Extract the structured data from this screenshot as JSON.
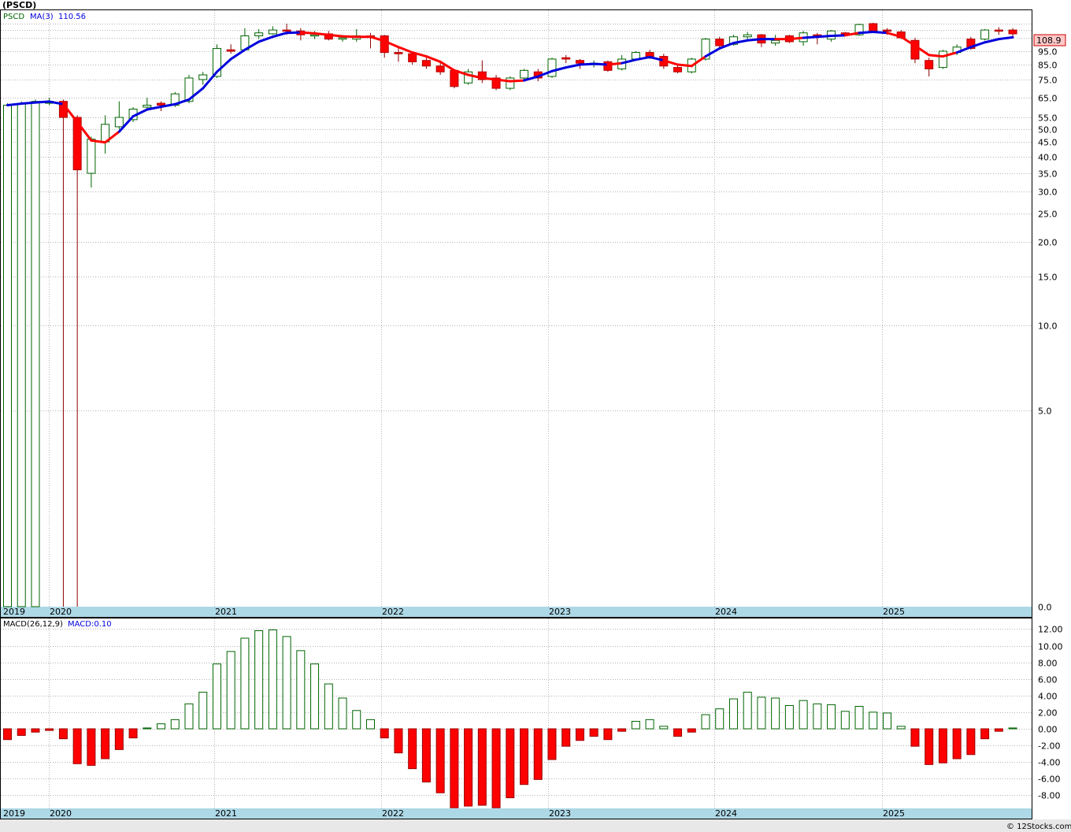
{
  "title": "(PSCD)",
  "footer": "© 12Stocks.com",
  "colors": {
    "up_candle": "#006400",
    "down_candle": "#ff0000",
    "ma_up": "#0000dd",
    "ma_down": "#ff0000",
    "axis_band": "#add8e6",
    "grid": "#b4b4b4",
    "price_badge": "#ffc8c8"
  },
  "chart_data": [
    {
      "type": "candlestick",
      "name": "price",
      "yscale": "log",
      "legend": {
        "symbol": "PSCD",
        "ma_label": "MA(3)",
        "ma_value": "110.56"
      },
      "last_price_label": "108.9",
      "y_ticks": [
        "0.0",
        "5.0",
        "10.0",
        "15.0",
        "20.0",
        "25.0",
        "30.0",
        "35.0",
        "40.0",
        "45.0",
        "50.0",
        "55.0",
        "65.0",
        "75.0",
        "85.0",
        "95.0",
        "105.0"
      ],
      "x_labels": [
        "2019",
        "2020",
        "2021",
        "2022",
        "2023",
        "2024",
        "2025"
      ],
      "grid": true,
      "candles": [
        {
          "o": 0.1,
          "h": 62,
          "l": 0.1,
          "c": 61,
          "dir": "up"
        },
        {
          "o": 0.1,
          "h": 63,
          "l": 0.1,
          "c": 62,
          "dir": "up"
        },
        {
          "o": 0.1,
          "h": 64,
          "l": 0.1,
          "c": 63,
          "dir": "up"
        },
        {
          "o": 62,
          "h": 65,
          "l": 61,
          "c": 63,
          "dir": "up"
        },
        {
          "o": 63,
          "h": 64,
          "l": 0.1,
          "c": 55,
          "dir": "down"
        },
        {
          "o": 55,
          "h": 56,
          "l": 0.1,
          "c": 36,
          "dir": "down"
        },
        {
          "o": 35,
          "h": 47,
          "l": 31,
          "c": 46,
          "dir": "up"
        },
        {
          "o": 45,
          "h": 56,
          "l": 41,
          "c": 52,
          "dir": "up"
        },
        {
          "o": 51,
          "h": 63,
          "l": 50,
          "c": 55,
          "dir": "up"
        },
        {
          "o": 54,
          "h": 60,
          "l": 53,
          "c": 59,
          "dir": "up"
        },
        {
          "o": 60,
          "h": 65,
          "l": 59,
          "c": 61,
          "dir": "up"
        },
        {
          "o": 61,
          "h": 63,
          "l": 58,
          "c": 62,
          "dir": "down"
        },
        {
          "o": 61,
          "h": 68,
          "l": 60,
          "c": 67,
          "dir": "up"
        },
        {
          "o": 63,
          "h": 78,
          "l": 62,
          "c": 76,
          "dir": "up"
        },
        {
          "o": 75,
          "h": 80,
          "l": 72,
          "c": 78,
          "dir": "up"
        },
        {
          "o": 77,
          "h": 100,
          "l": 76,
          "c": 97,
          "dir": "up"
        },
        {
          "o": 95,
          "h": 100,
          "l": 93,
          "c": 96,
          "dir": "down"
        },
        {
          "o": 96,
          "h": 115,
          "l": 95,
          "c": 107,
          "dir": "up"
        },
        {
          "o": 107,
          "h": 114,
          "l": 104,
          "c": 110,
          "dir": "up"
        },
        {
          "o": 109,
          "h": 117,
          "l": 108,
          "c": 113,
          "dir": "up"
        },
        {
          "o": 113,
          "h": 120,
          "l": 108,
          "c": 112,
          "dir": "down"
        },
        {
          "o": 112,
          "h": 115,
          "l": 103,
          "c": 108,
          "dir": "down"
        },
        {
          "o": 108,
          "h": 112,
          "l": 104,
          "c": 108,
          "dir": "up"
        },
        {
          "o": 109,
          "h": 112,
          "l": 103,
          "c": 104,
          "dir": "down"
        },
        {
          "o": 104,
          "h": 107,
          "l": 102,
          "c": 105,
          "dir": "up"
        },
        {
          "o": 104,
          "h": 114,
          "l": 102,
          "c": 107,
          "dir": "up"
        },
        {
          "o": 107,
          "h": 110,
          "l": 97,
          "c": 106,
          "dir": "down"
        },
        {
          "o": 107,
          "h": 108,
          "l": 90,
          "c": 94,
          "dir": "down"
        },
        {
          "o": 94,
          "h": 97,
          "l": 87,
          "c": 93,
          "dir": "down"
        },
        {
          "o": 93,
          "h": 95,
          "l": 85,
          "c": 87,
          "dir": "down"
        },
        {
          "o": 88,
          "h": 90,
          "l": 82,
          "c": 84,
          "dir": "down"
        },
        {
          "o": 84,
          "h": 86,
          "l": 78,
          "c": 80,
          "dir": "down"
        },
        {
          "o": 81,
          "h": 82,
          "l": 70,
          "c": 71,
          "dir": "down"
        },
        {
          "o": 73,
          "h": 82,
          "l": 72,
          "c": 80,
          "dir": "up"
        },
        {
          "o": 80,
          "h": 88,
          "l": 73,
          "c": 75,
          "dir": "down"
        },
        {
          "o": 76,
          "h": 78,
          "l": 69,
          "c": 70,
          "dir": "down"
        },
        {
          "o": 70,
          "h": 77,
          "l": 69,
          "c": 76,
          "dir": "up"
        },
        {
          "o": 76,
          "h": 82,
          "l": 75,
          "c": 81,
          "dir": "up"
        },
        {
          "o": 80,
          "h": 82,
          "l": 74,
          "c": 76,
          "dir": "down"
        },
        {
          "o": 77,
          "h": 90,
          "l": 76,
          "c": 89,
          "dir": "up"
        },
        {
          "o": 89,
          "h": 92,
          "l": 86,
          "c": 90,
          "dir": "down"
        },
        {
          "o": 88,
          "h": 89,
          "l": 82,
          "c": 86,
          "dir": "down"
        },
        {
          "o": 86,
          "h": 88,
          "l": 83,
          "c": 85,
          "dir": "up"
        },
        {
          "o": 87,
          "h": 88,
          "l": 80,
          "c": 81,
          "dir": "down"
        },
        {
          "o": 82,
          "h": 92,
          "l": 81,
          "c": 89,
          "dir": "up"
        },
        {
          "o": 89,
          "h": 95,
          "l": 88,
          "c": 94,
          "dir": "up"
        },
        {
          "o": 94,
          "h": 96,
          "l": 89,
          "c": 91,
          "dir": "down"
        },
        {
          "o": 91,
          "h": 93,
          "l": 82,
          "c": 84,
          "dir": "down"
        },
        {
          "o": 83,
          "h": 85,
          "l": 79,
          "c": 80,
          "dir": "down"
        },
        {
          "o": 80,
          "h": 90,
          "l": 79,
          "c": 89,
          "dir": "up"
        },
        {
          "o": 89,
          "h": 105,
          "l": 88,
          "c": 104,
          "dir": "up"
        },
        {
          "o": 104,
          "h": 106,
          "l": 97,
          "c": 99,
          "dir": "down"
        },
        {
          "o": 100,
          "h": 108,
          "l": 99,
          "c": 106,
          "dir": "up"
        },
        {
          "o": 106,
          "h": 111,
          "l": 104,
          "c": 108,
          "dir": "up"
        },
        {
          "o": 108,
          "h": 109,
          "l": 98,
          "c": 101,
          "dir": "down"
        },
        {
          "o": 101,
          "h": 108,
          "l": 99,
          "c": 103,
          "dir": "up"
        },
        {
          "o": 107,
          "h": 108,
          "l": 101,
          "c": 102,
          "dir": "down"
        },
        {
          "o": 102,
          "h": 112,
          "l": 99,
          "c": 110,
          "dir": "up"
        },
        {
          "o": 108,
          "h": 110,
          "l": 100,
          "c": 107,
          "dir": "down"
        },
        {
          "o": 104,
          "h": 113,
          "l": 102,
          "c": 112,
          "dir": "up"
        },
        {
          "o": 110,
          "h": 111,
          "l": 107,
          "c": 108,
          "dir": "down"
        },
        {
          "o": 108,
          "h": 120,
          "l": 107,
          "c": 119,
          "dir": "up"
        },
        {
          "o": 120,
          "h": 121,
          "l": 111,
          "c": 112,
          "dir": "down"
        },
        {
          "o": 113,
          "h": 115,
          "l": 108,
          "c": 112,
          "dir": "down"
        },
        {
          "o": 111,
          "h": 113,
          "l": 104,
          "c": 105,
          "dir": "down"
        },
        {
          "o": 103,
          "h": 105,
          "l": 86,
          "c": 89,
          "dir": "down"
        },
        {
          "o": 88,
          "h": 90,
          "l": 77,
          "c": 82,
          "dir": "down"
        },
        {
          "o": 83,
          "h": 96,
          "l": 82,
          "c": 95,
          "dir": "up"
        },
        {
          "o": 94,
          "h": 100,
          "l": 92,
          "c": 98,
          "dir": "up"
        },
        {
          "o": 97,
          "h": 106,
          "l": 96,
          "c": 104,
          "dir": "down"
        },
        {
          "o": 104,
          "h": 114,
          "l": 103,
          "c": 113,
          "dir": "up"
        },
        {
          "o": 113,
          "h": 116,
          "l": 108,
          "c": 112,
          "dir": "down"
        },
        {
          "o": 113,
          "h": 115,
          "l": 106,
          "c": 109,
          "dir": "down"
        }
      ],
      "ma": [
        61,
        61.8,
        62.4,
        62.9,
        61.5,
        53,
        45.5,
        44.8,
        49,
        55.5,
        58.8,
        60.2,
        61.5,
        64,
        70,
        80,
        89,
        96,
        102,
        106,
        110,
        110.5,
        109.5,
        108,
        106.5,
        106,
        106,
        102.5,
        98,
        94,
        91,
        87,
        81,
        78,
        76,
        75,
        74,
        74.5,
        77,
        80.5,
        83,
        85,
        85.5,
        85,
        86,
        88.5,
        90.5,
        88,
        85,
        84,
        91,
        97,
        101,
        103,
        104,
        104,
        104,
        105,
        106,
        107,
        107.5,
        110,
        111,
        110,
        106,
        99,
        92,
        91,
        94,
        98,
        101.5,
        104,
        105.5
      ],
      "ma_dir": [
        "up",
        "up",
        "up",
        "up",
        "down",
        "down",
        "down",
        "down",
        "up",
        "up",
        "up",
        "up",
        "up",
        "up",
        "up",
        "up",
        "up",
        "up",
        "up",
        "up",
        "up",
        "down",
        "down",
        "down",
        "down",
        "down",
        "down",
        "down",
        "down",
        "down",
        "down",
        "down",
        "down",
        "down",
        "down",
        "down",
        "down",
        "up",
        "up",
        "up",
        "up",
        "up",
        "up",
        "down",
        "up",
        "up",
        "up",
        "down",
        "down",
        "down",
        "up",
        "up",
        "up",
        "up",
        "up",
        "down",
        "down",
        "up",
        "up",
        "up",
        "down",
        "up",
        "up",
        "down",
        "down",
        "down",
        "down",
        "down",
        "up",
        "up",
        "up",
        "up",
        "down"
      ]
    },
    {
      "type": "bar",
      "name": "MACD histogram",
      "legend": {
        "label": "MACD(26,12,9)",
        "value_label": "MACD:0.10"
      },
      "y_ticks": [
        "12.00",
        "10.00",
        "8.00",
        "6.00",
        "4.00",
        "2.00",
        "0.00",
        "-2.00",
        "-4.00",
        "-6.00",
        "-8.00"
      ],
      "ylim": [
        -9.5,
        12.5
      ],
      "x_labels": [
        "2019",
        "2020",
        "2021",
        "2022",
        "2023",
        "2024",
        "2025"
      ],
      "grid": true,
      "values": [
        -1.3,
        -0.8,
        -0.4,
        -0.2,
        -1.2,
        -4.2,
        -4.4,
        -3.6,
        -2.5,
        -1.1,
        0.1,
        0.6,
        1.1,
        3.0,
        4.4,
        7.8,
        9.3,
        10.9,
        11.8,
        11.9,
        11.1,
        9.4,
        7.8,
        5.4,
        3.7,
        2.2,
        1.1,
        -1.1,
        -2.9,
        -4.8,
        -6.4,
        -7.7,
        -9.5,
        -9.3,
        -9.2,
        -9.5,
        -8.3,
        -6.7,
        -6.1,
        -3.7,
        -2.1,
        -1.4,
        -0.9,
        -1.3,
        -0.3,
        0.9,
        1.1,
        0.3,
        -0.9,
        -0.4,
        1.7,
        2.4,
        3.6,
        4.4,
        3.8,
        3.7,
        2.8,
        3.4,
        3.0,
        2.9,
        2.1,
        2.7,
        2.0,
        1.9,
        0.3,
        -2.1,
        -4.3,
        -4.1,
        -3.6,
        -3.1,
        -1.2,
        -0.3,
        0.1
      ],
      "signs": [
        "down",
        "down",
        "down",
        "down",
        "down",
        "down",
        "down",
        "down",
        "down",
        "down",
        "up",
        "up",
        "up",
        "up",
        "up",
        "up",
        "up",
        "up",
        "up",
        "up",
        "up",
        "up",
        "up",
        "up",
        "up",
        "up",
        "up",
        "down",
        "down",
        "down",
        "down",
        "down",
        "down",
        "down",
        "down",
        "down",
        "down",
        "down",
        "down",
        "down",
        "down",
        "down",
        "down",
        "down",
        "down",
        "up",
        "up",
        "up",
        "down",
        "down",
        "up",
        "up",
        "up",
        "up",
        "up",
        "up",
        "up",
        "up",
        "up",
        "up",
        "up",
        "up",
        "up",
        "up",
        "up",
        "down",
        "down",
        "down",
        "down",
        "down",
        "down",
        "down",
        "up"
      ]
    }
  ]
}
